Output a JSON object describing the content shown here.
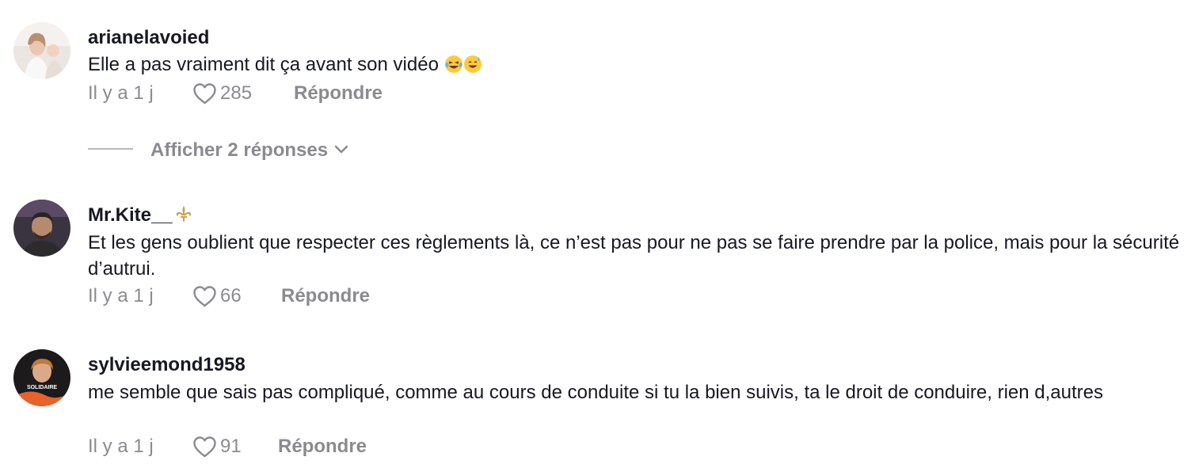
{
  "comments": [
    {
      "username": "arianelavoied",
      "text": "Elle a pas vraiment dit ça avant son vidéo",
      "emojis": [
        "laughing-tears-emoji",
        "sweat-smile-emoji"
      ],
      "time": "Il y a 1 j",
      "likes": "285",
      "reply_label": "Répondre",
      "show_replies_label": "Afficher 2 réponses"
    },
    {
      "username": "Mr.Kite__",
      "badge_icon": "fleur-de-lis-icon",
      "text": "Et les gens oublient que respecter ces règlements là, ce n’est pas pour ne pas se faire prendre par la police, mais pour la sécurité d’autrui.",
      "time": "Il y a 1 j",
      "likes": "66",
      "reply_label": "Répondre"
    },
    {
      "username": "sylvieemond1958",
      "avatar_text": "SOLIDAIRE",
      "text": "me semble que sais pas compliqué, comme au cours de conduite si tu la bien suivis, ta le droit de conduire, rien d,autres",
      "time": "Il y a 1 j",
      "likes": "91",
      "reply_label": "Répondre"
    }
  ],
  "colors": {
    "text_primary": "#161823",
    "text_secondary": "#8a8b91",
    "fleur_gold": "#c9a24a",
    "avatar_orange": "#e8622a"
  }
}
